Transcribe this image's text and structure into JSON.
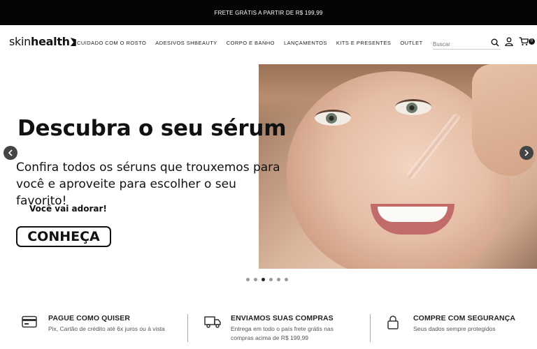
{
  "announcement": "FRETE GRÁTIS A PARTIR DE R$ 199,99",
  "logo": {
    "part1": "skin",
    "part2": "health"
  },
  "nav": [
    "CUIDADO COM O ROSTO",
    "ADESIVOS SHBEAUTY",
    "CORPO E BANHO",
    "LANÇAMENTOS",
    "KITS E PRESENTES",
    "OUTLET"
  ],
  "search": {
    "placeholder": "Buscar",
    "icon": "search-icon"
  },
  "cart": {
    "count": "0"
  },
  "hero": {
    "title": "Descubra o seu sérum",
    "subtitle": "Confira todos os séruns que trouxemos para você e aproveite para escolher o seu favorito!",
    "tagline": "Você vai adorar!",
    "cta": "CONHEÇA",
    "slides_total": 6,
    "active_slide": 3
  },
  "features": [
    {
      "icon": "credit-card-icon",
      "title": "PAGUE COMO QUISER",
      "desc": "Pix, Cartão de crédito até 6x juros ou à vista"
    },
    {
      "icon": "truck-icon",
      "title": "ENVIAMOS SUAS COMPRAS",
      "desc": "Entrega em todo o país frete grátis nas compras acima de R$ 199,99"
    },
    {
      "icon": "lock-icon",
      "title": "COMPRE COM SEGURANÇA",
      "desc": "Seus dados sempre protegidos"
    }
  ],
  "colors": {
    "topbar": "#050505",
    "text": "#111111",
    "dot_active": "#222222",
    "dot": "#999999"
  }
}
